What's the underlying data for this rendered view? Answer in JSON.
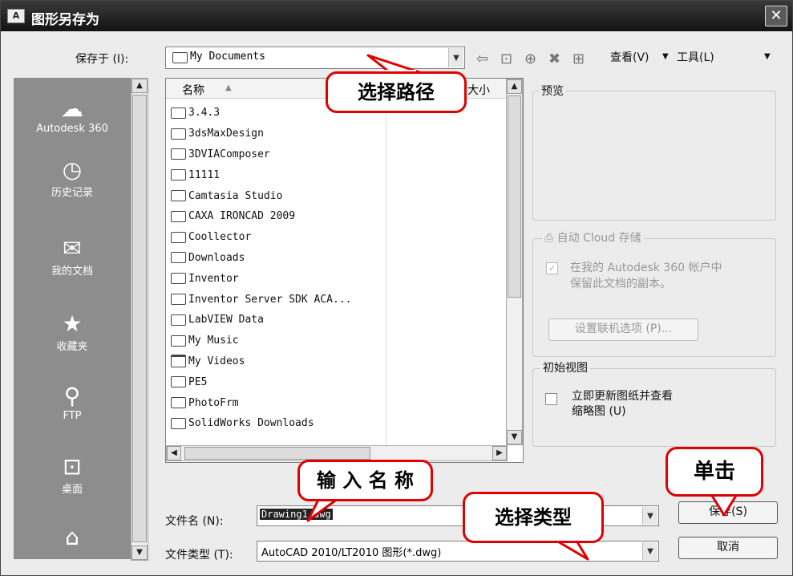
{
  "window": {
    "title": "图形另存为",
    "app_icon_text": "A"
  },
  "toolbar": {
    "save_in_label": "保存于 (I):",
    "save_in_value": "My Documents",
    "view_menu": "查看(V)",
    "tools_menu": "工具(L)"
  },
  "places": [
    "Autodesk 360",
    "历史记录",
    "我的文档",
    "收藏夹",
    "FTP",
    "桌面"
  ],
  "file_list": {
    "col_name": "名称",
    "col_size": "大小",
    "items": [
      "3.4.3",
      "3dsMaxDesign",
      "3DVIAComposer",
      "11111",
      "Camtasia Studio",
      "CAXA IRONCAD 2009",
      "Coollector",
      "Downloads",
      "Inventor",
      "Inventor Server SDK ACA...",
      "LabVIEW Data",
      "My Music",
      "My Videos",
      "PE5",
      "PhotoFrm",
      "SolidWorks Downloads"
    ]
  },
  "preview": {
    "title": "预览"
  },
  "cloud": {
    "title": "自动 Cloud 存储",
    "checkbox_text_line1": "在我的 Autodesk 360 帐户中",
    "checkbox_text_line2": "保留此文档的副本。",
    "online_options_button": "设置联机选项 (P)..."
  },
  "initial_view": {
    "title": "初始视图",
    "checkbox_line1": "立即更新图纸并查看",
    "checkbox_line2": "缩略图 (U)"
  },
  "filename": {
    "label": "文件名 (N):",
    "value": "Drawing1.dwg"
  },
  "filetype": {
    "label": "文件类型 (T):",
    "value": "AutoCAD 2010/LT2010 图形(*.dwg)"
  },
  "buttons": {
    "save": "保存(S)",
    "cancel": "取消"
  },
  "callouts": {
    "select_path": "选择路径",
    "enter_name": "输 入 名 称",
    "select_type": "选择类型",
    "click": "单击"
  },
  "colors": {
    "callout_border": "#e00000",
    "titlebar": "#1e1e1e",
    "places_bg": "#8d8d8d"
  }
}
